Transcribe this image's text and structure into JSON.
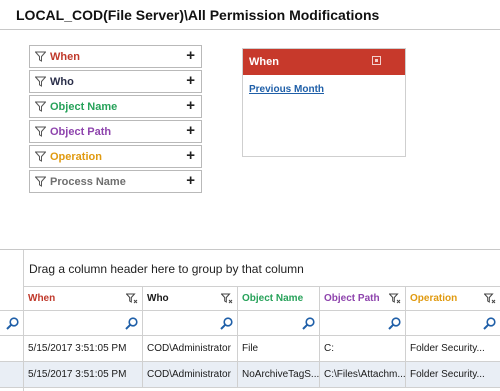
{
  "title": "LOCAL_COD(File Server)\\All Permission Modifications",
  "filters": [
    {
      "label": "When",
      "color": "#c0392b"
    },
    {
      "label": "Who",
      "color": "#2b2f4a"
    },
    {
      "label": "Object Name",
      "color": "#27a25a"
    },
    {
      "label": "Object Path",
      "color": "#8e44ad"
    },
    {
      "label": "Operation",
      "color": "#e09a10"
    },
    {
      "label": "Process Name",
      "color": "#6f6f6f"
    }
  ],
  "when_panel": {
    "title": "When",
    "link": "Previous Month",
    "accent": "#c7392b"
  },
  "grid": {
    "group_hint": "Drag a column header here to group by that column",
    "columns": [
      {
        "label": "When",
        "color": "#c0392b"
      },
      {
        "label": "Who",
        "color": "#1a1a1a"
      },
      {
        "label": "Object Name",
        "color": "#27a25a"
      },
      {
        "label": "Object Path",
        "color": "#8e44ad"
      },
      {
        "label": "Operation",
        "color": "#e09a10"
      }
    ],
    "rows": [
      [
        "5/15/2017 3:51:05 PM",
        "COD\\Administrator",
        "File",
        "C:",
        "Folder Security..."
      ],
      [
        "5/15/2017 3:51:05 PM",
        "COD\\Administrator",
        "NoArchiveTagS...",
        "C:\\Files\\Attachm...",
        "Folder Security..."
      ]
    ]
  }
}
